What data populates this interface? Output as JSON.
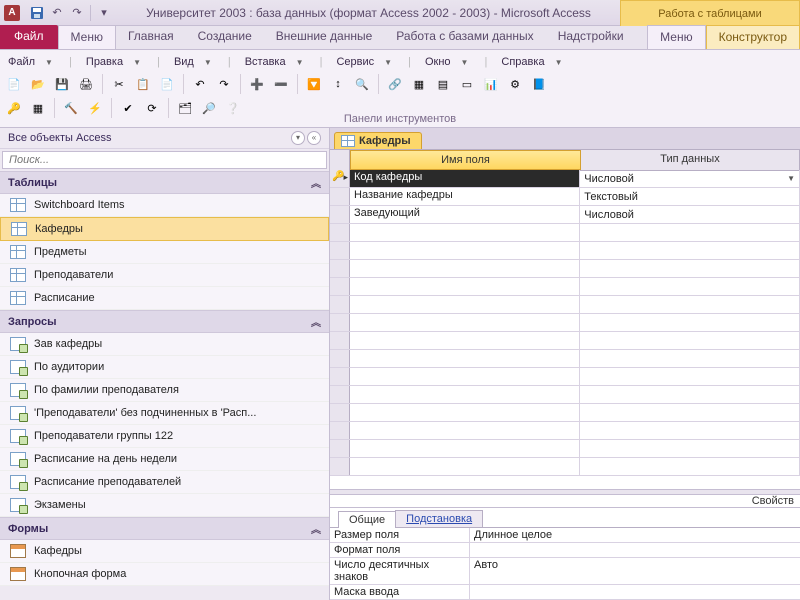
{
  "titlebar": {
    "app_letter": "A",
    "title": "Университет 2003 : база данных (формат Access 2002 - 2003)  -  Microsoft Access",
    "table_tools": "Работа с таблицами"
  },
  "ribbon": {
    "file": "Файл",
    "tabs": [
      "Меню",
      "Главная",
      "Создание",
      "Внешние данные",
      "Работа с базами данных",
      "Надстройки"
    ],
    "active_tab": "Меню",
    "tool_tab": "Конструктор",
    "menus": {
      "file": "Файл",
      "edit": "Правка",
      "view": "Вид",
      "insert": "Вставка",
      "service": "Сервис",
      "window": "Окно",
      "help": "Справка"
    },
    "group_label": "Панели инструментов"
  },
  "nav": {
    "header": "Все объекты Access",
    "search_placeholder": "Поиск...",
    "groups": [
      {
        "title": "Таблицы",
        "type": "table",
        "items": [
          "Switchboard Items",
          "Кафедры",
          "Предметы",
          "Преподаватели",
          "Расписание"
        ],
        "selected": 1
      },
      {
        "title": "Запросы",
        "type": "query",
        "items": [
          "Зав кафедры",
          "По аудитории",
          "По фамилии преподавателя",
          "'Преподаватели' без подчиненных в 'Расп...",
          "Преподаватели группы 122",
          "Расписание на день недели",
          "Расписание преподавателей",
          "Экзамены"
        ]
      },
      {
        "title": "Формы",
        "type": "form",
        "items": [
          "Кафедры",
          "Кнопочная форма"
        ]
      }
    ]
  },
  "doc": {
    "tab_label": "Кафедры",
    "columns": {
      "field_name": "Имя поля",
      "data_type": "Тип данных"
    },
    "rows": [
      {
        "name": "Код кафедры",
        "type": "Числовой",
        "pk": true,
        "editing": true
      },
      {
        "name": "Название кафедры",
        "type": "Текстовый"
      },
      {
        "name": "Заведующий",
        "type": "Числовой"
      }
    ]
  },
  "props": {
    "title": "Свойств",
    "tabs": {
      "general": "Общие",
      "lookup": "Подстановка"
    },
    "rows": [
      {
        "label": "Размер поля",
        "value": "Длинное целое"
      },
      {
        "label": "Формат поля",
        "value": ""
      },
      {
        "label": "Число десятичных знаков",
        "value": "Авто"
      },
      {
        "label": "Маска ввода",
        "value": ""
      }
    ]
  }
}
